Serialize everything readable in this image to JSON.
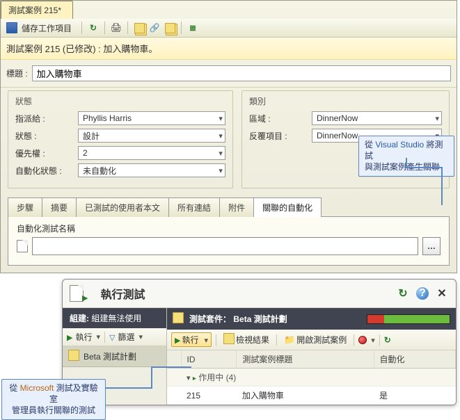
{
  "tab_title": "測試案例 215*",
  "toolbar": {
    "save_label": "儲存工作項目"
  },
  "banner_text": "測試案例 215 (已修改) : 加入購物車。",
  "title_row": {
    "label": "標題 :",
    "value": "加入購物車"
  },
  "status_group": {
    "legend": "狀態",
    "rows": [
      {
        "label": "指派給 :",
        "value": "Phyllis Harris"
      },
      {
        "label": "狀態 :",
        "value": "設計"
      },
      {
        "label": "優先權 :",
        "value": "2"
      },
      {
        "label": "自動化狀態 :",
        "value": "未自動化"
      }
    ]
  },
  "category_group": {
    "legend": "類別",
    "rows": [
      {
        "label": "區域 :",
        "value": "DinnerNow"
      },
      {
        "label": "反覆項目 :",
        "value": "DinnerNow"
      }
    ]
  },
  "callout_vs": {
    "line1": "從 Visual Studio 將測試",
    "line2": "與測試案例產生關聯"
  },
  "tabs": [
    "步驟",
    "摘要",
    "已測試的使用者本文",
    "所有連結",
    "附件",
    "關聯的自動化"
  ],
  "auto_name_label": "自動化測試名稱",
  "run_panel": {
    "title": "執行測試",
    "build_label": "組建:",
    "build_value": "組建無法使用",
    "left_run": "執行",
    "left_filter": "篩選",
    "plan_name": "Beta 測試計劃",
    "suite_label": "測試套件：",
    "suite_value": "Beta 測試計劃",
    "right_tools": {
      "run": "執行",
      "view": "檢視結果",
      "open": "開啟測試案例"
    },
    "columns": [
      "ID",
      "測試案例標題",
      "自動化"
    ],
    "group_row": "作用中 (4)",
    "row": {
      "id": "215",
      "title": "加入購物車",
      "auto": "是"
    }
  },
  "callout_mtm": {
    "line1": "從 Microsoft 測試及實驗室",
    "line2": "管理員執行關聯的測試"
  }
}
